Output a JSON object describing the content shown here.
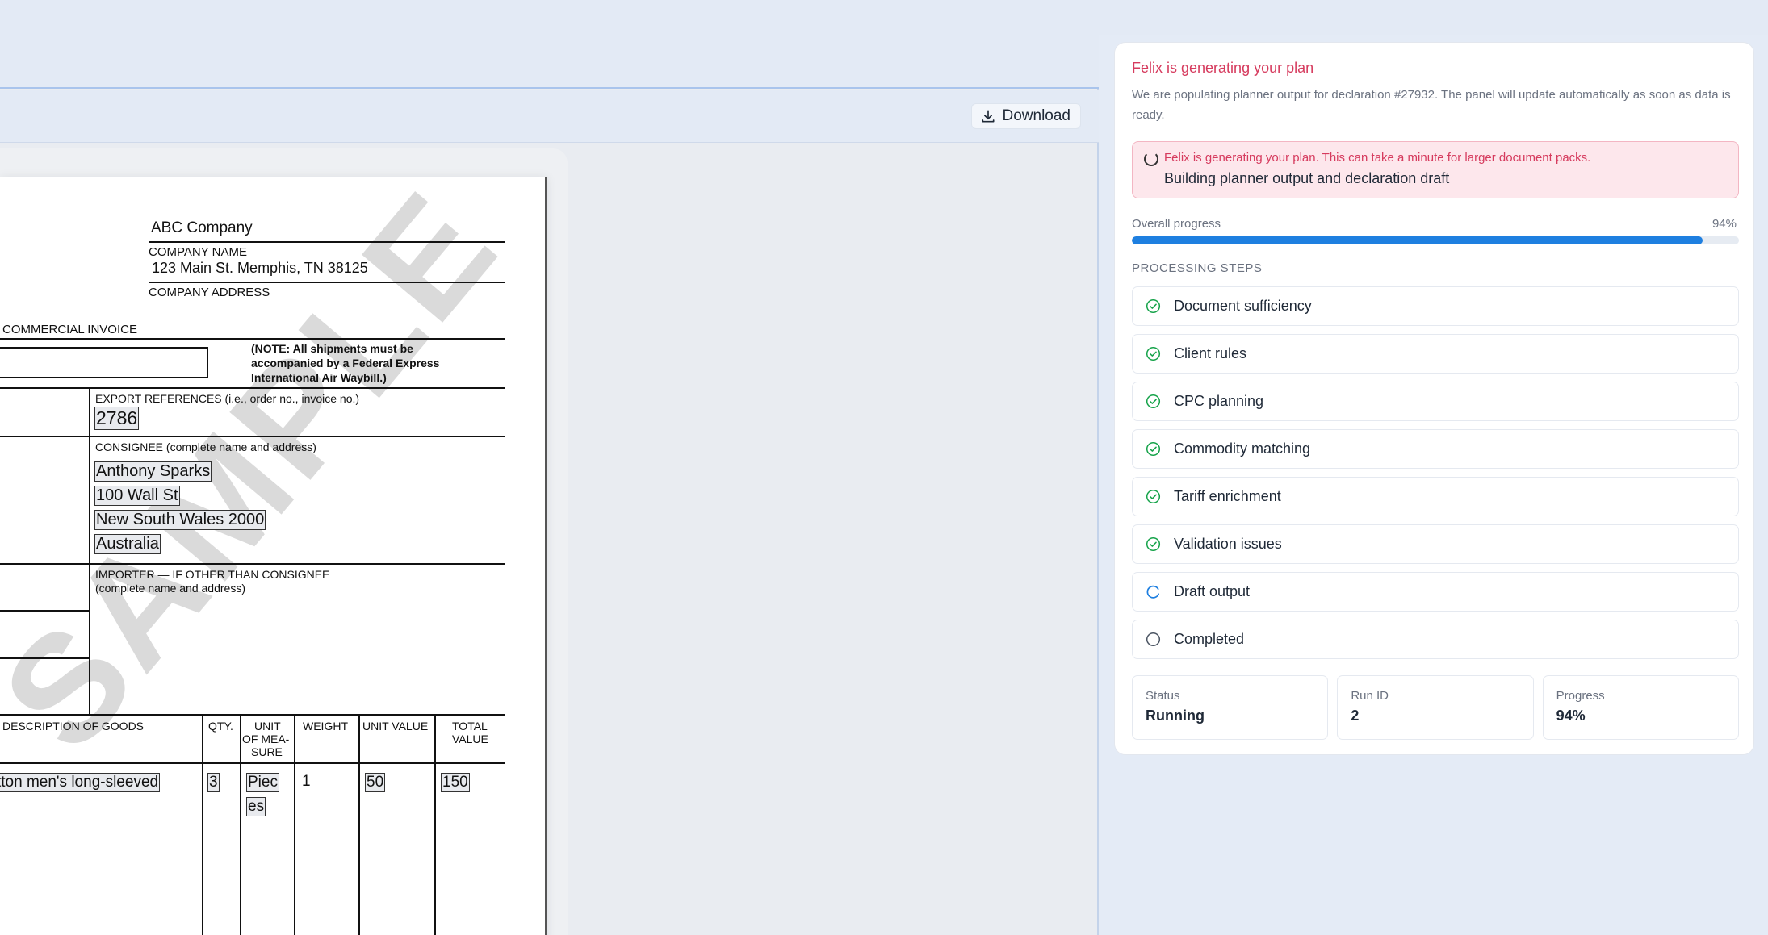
{
  "toolbar": {
    "download_label": "Download"
  },
  "document": {
    "company_name": "ABC Company",
    "company_name_label": "COMPANY NAME",
    "company_address": "123 Main St. Memphis, TN 38125",
    "company_address_label": "COMPANY ADDRESS",
    "form_title": "COMMERCIAL INVOICE",
    "note_line1": "(NOTE: All shipments must be",
    "note_line2": "accompanied by a Federal Express",
    "note_line3": "International Air Waybill.)",
    "export_ref_label": "EXPORT REFERENCES (i.e., order no., invoice no.)",
    "export_ref_value": "2786",
    "consignee_label": "CONSIGNEE (complete name and address)",
    "consignee_name": "Anthony Sparks",
    "consignee_street": "100 Wall St",
    "consignee_city": "New South Wales 2000",
    "consignee_country": "Australia",
    "importer_label1": "IMPORTER — IF OTHER THAN CONSIGNEE",
    "importer_label2": "(complete name and address)",
    "watermark": "SAMPLE",
    "columns": {
      "description": "DESCRIPTION OF GOODS",
      "qty": "QTY.",
      "uom_1": "UNIT",
      "uom_2": "OF MEA-",
      "uom_3": "SURE",
      "weight": "WEIGHT",
      "unit_value": "UNIT VALUE",
      "total_value_1": "TOTAL",
      "total_value_2": "VALUE"
    },
    "row": {
      "description": "tton men's long-sleeved",
      "qty": "3",
      "uom_1": "Piec",
      "uom_2": "es",
      "weight": "1",
      "unit_value": "50",
      "total_value": "150"
    }
  },
  "panel": {
    "title": "Felix is generating your plan",
    "description": "We are populating planner output for declaration #27932. The panel will update automatically as soon as data is ready.",
    "alert_line1": "Felix is generating your plan. This can take a minute for larger document packs.",
    "alert_line2": "Building planner output and declaration draft",
    "progress_label": "Overall progress",
    "progress_value": "94%",
    "progress_fraction": 0.94,
    "steps_heading": "PROCESSING STEPS",
    "steps": [
      {
        "label": "Document sufficiency",
        "state": "done"
      },
      {
        "label": "Client rules",
        "state": "done"
      },
      {
        "label": "CPC planning",
        "state": "done"
      },
      {
        "label": "Commodity matching",
        "state": "done"
      },
      {
        "label": "Tariff enrichment",
        "state": "done"
      },
      {
        "label": "Validation issues",
        "state": "done"
      },
      {
        "label": "Draft output",
        "state": "in-progress"
      },
      {
        "label": "Completed",
        "state": "pending"
      }
    ],
    "stats": {
      "status_label": "Status",
      "status_value": "Running",
      "run_label": "Run ID",
      "run_value": "2",
      "progress_label": "Progress",
      "progress_value": "94%"
    }
  },
  "colors": {
    "accent": "#d63b5e",
    "progress": "#1e7fe0",
    "success": "#16a34a",
    "spinner": "#1e7fe0"
  }
}
